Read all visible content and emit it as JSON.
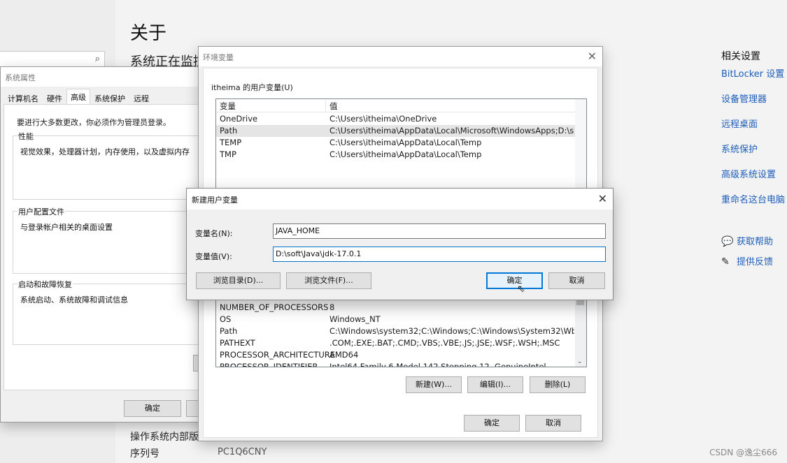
{
  "settings": {
    "title": "关于",
    "monitoring_text": "系统正在监控",
    "specs": [
      {
        "label": "操作系统内部版本",
        "value": ""
      },
      {
        "label": "序列号",
        "value": "PC1Q6CNY"
      }
    ],
    "related": {
      "header": "相关设置",
      "links": [
        "BitLocker 设置",
        "设备管理器",
        "远程桌面",
        "系统保护",
        "高级系统设置",
        "重命名这台电脑"
      ]
    },
    "help": {
      "get_help": "获取帮助",
      "feedback": "提供反馈"
    }
  },
  "sysprop": {
    "title": "系统属性",
    "tabs": [
      "计算机名",
      "硬件",
      "高级",
      "系统保护",
      "远程"
    ],
    "admin_note": "要进行大多数更改，你必须作为管理员登录。",
    "groups": [
      {
        "label": "性能",
        "text": "视觉效果，处理器计划，内存使用，以及虚拟内存"
      },
      {
        "label": "用户配置文件",
        "text": "与登录帐户相关的桌面设置"
      },
      {
        "label": "启动和故障恢复",
        "text": "系统启动、系统故障和调试信息"
      }
    ],
    "ok": "确定"
  },
  "envvars": {
    "title": "环境变量",
    "user_group": "itheima 的用户变量(U)",
    "columns": [
      "变量",
      "值"
    ],
    "user_vars": [
      {
        "name": "OneDrive",
        "value": "C:\\Users\\itheima\\OneDrive"
      },
      {
        "name": "Path",
        "value": "C:\\Users\\itheima\\AppData\\Local\\Microsoft\\WindowsApps;D:\\s..."
      },
      {
        "name": "TEMP",
        "value": "C:\\Users\\itheima\\AppData\\Local\\Temp"
      },
      {
        "name": "TMP",
        "value": "C:\\Users\\itheima\\AppData\\Local\\Temp"
      }
    ],
    "system_vars": [
      {
        "name": "NUMBER_OF_PROCESSORS",
        "value": "8"
      },
      {
        "name": "OS",
        "value": "Windows_NT"
      },
      {
        "name": "Path",
        "value": "C:\\Windows\\system32;C:\\Windows;C:\\Windows\\System32\\Wbe..."
      },
      {
        "name": "PATHEXT",
        "value": ".COM;.EXE;.BAT;.CMD;.VBS;.VBE;.JS;.JSE;.WSF;.WSH;.MSC"
      },
      {
        "name": "PROCESSOR_ARCHITECTURE",
        "value": "AMD64"
      },
      {
        "name": "PROCESSOR_IDENTIFIER",
        "value": "Intel64 Family 6 Model 142 Stepping 12, GenuineIntel"
      }
    ],
    "new_btn": "新建(W)...",
    "edit_btn": "编辑(I)...",
    "delete_btn": "删除(L)",
    "ok": "确定",
    "cancel": "取消"
  },
  "newvar": {
    "title": "新建用户变量",
    "name_label": "变量名(N):",
    "name_value": "JAVA_HOME",
    "value_label": "变量值(V):",
    "value_value": "D:\\soft\\Java\\jdk-17.0.1",
    "browse_dir": "浏览目录(D)...",
    "browse_file": "浏览文件(F)...",
    "ok": "确定",
    "cancel": "取消"
  },
  "icons": {
    "close": "close-icon",
    "search": "search-icon"
  },
  "watermark": "CSDN @逸尘666"
}
